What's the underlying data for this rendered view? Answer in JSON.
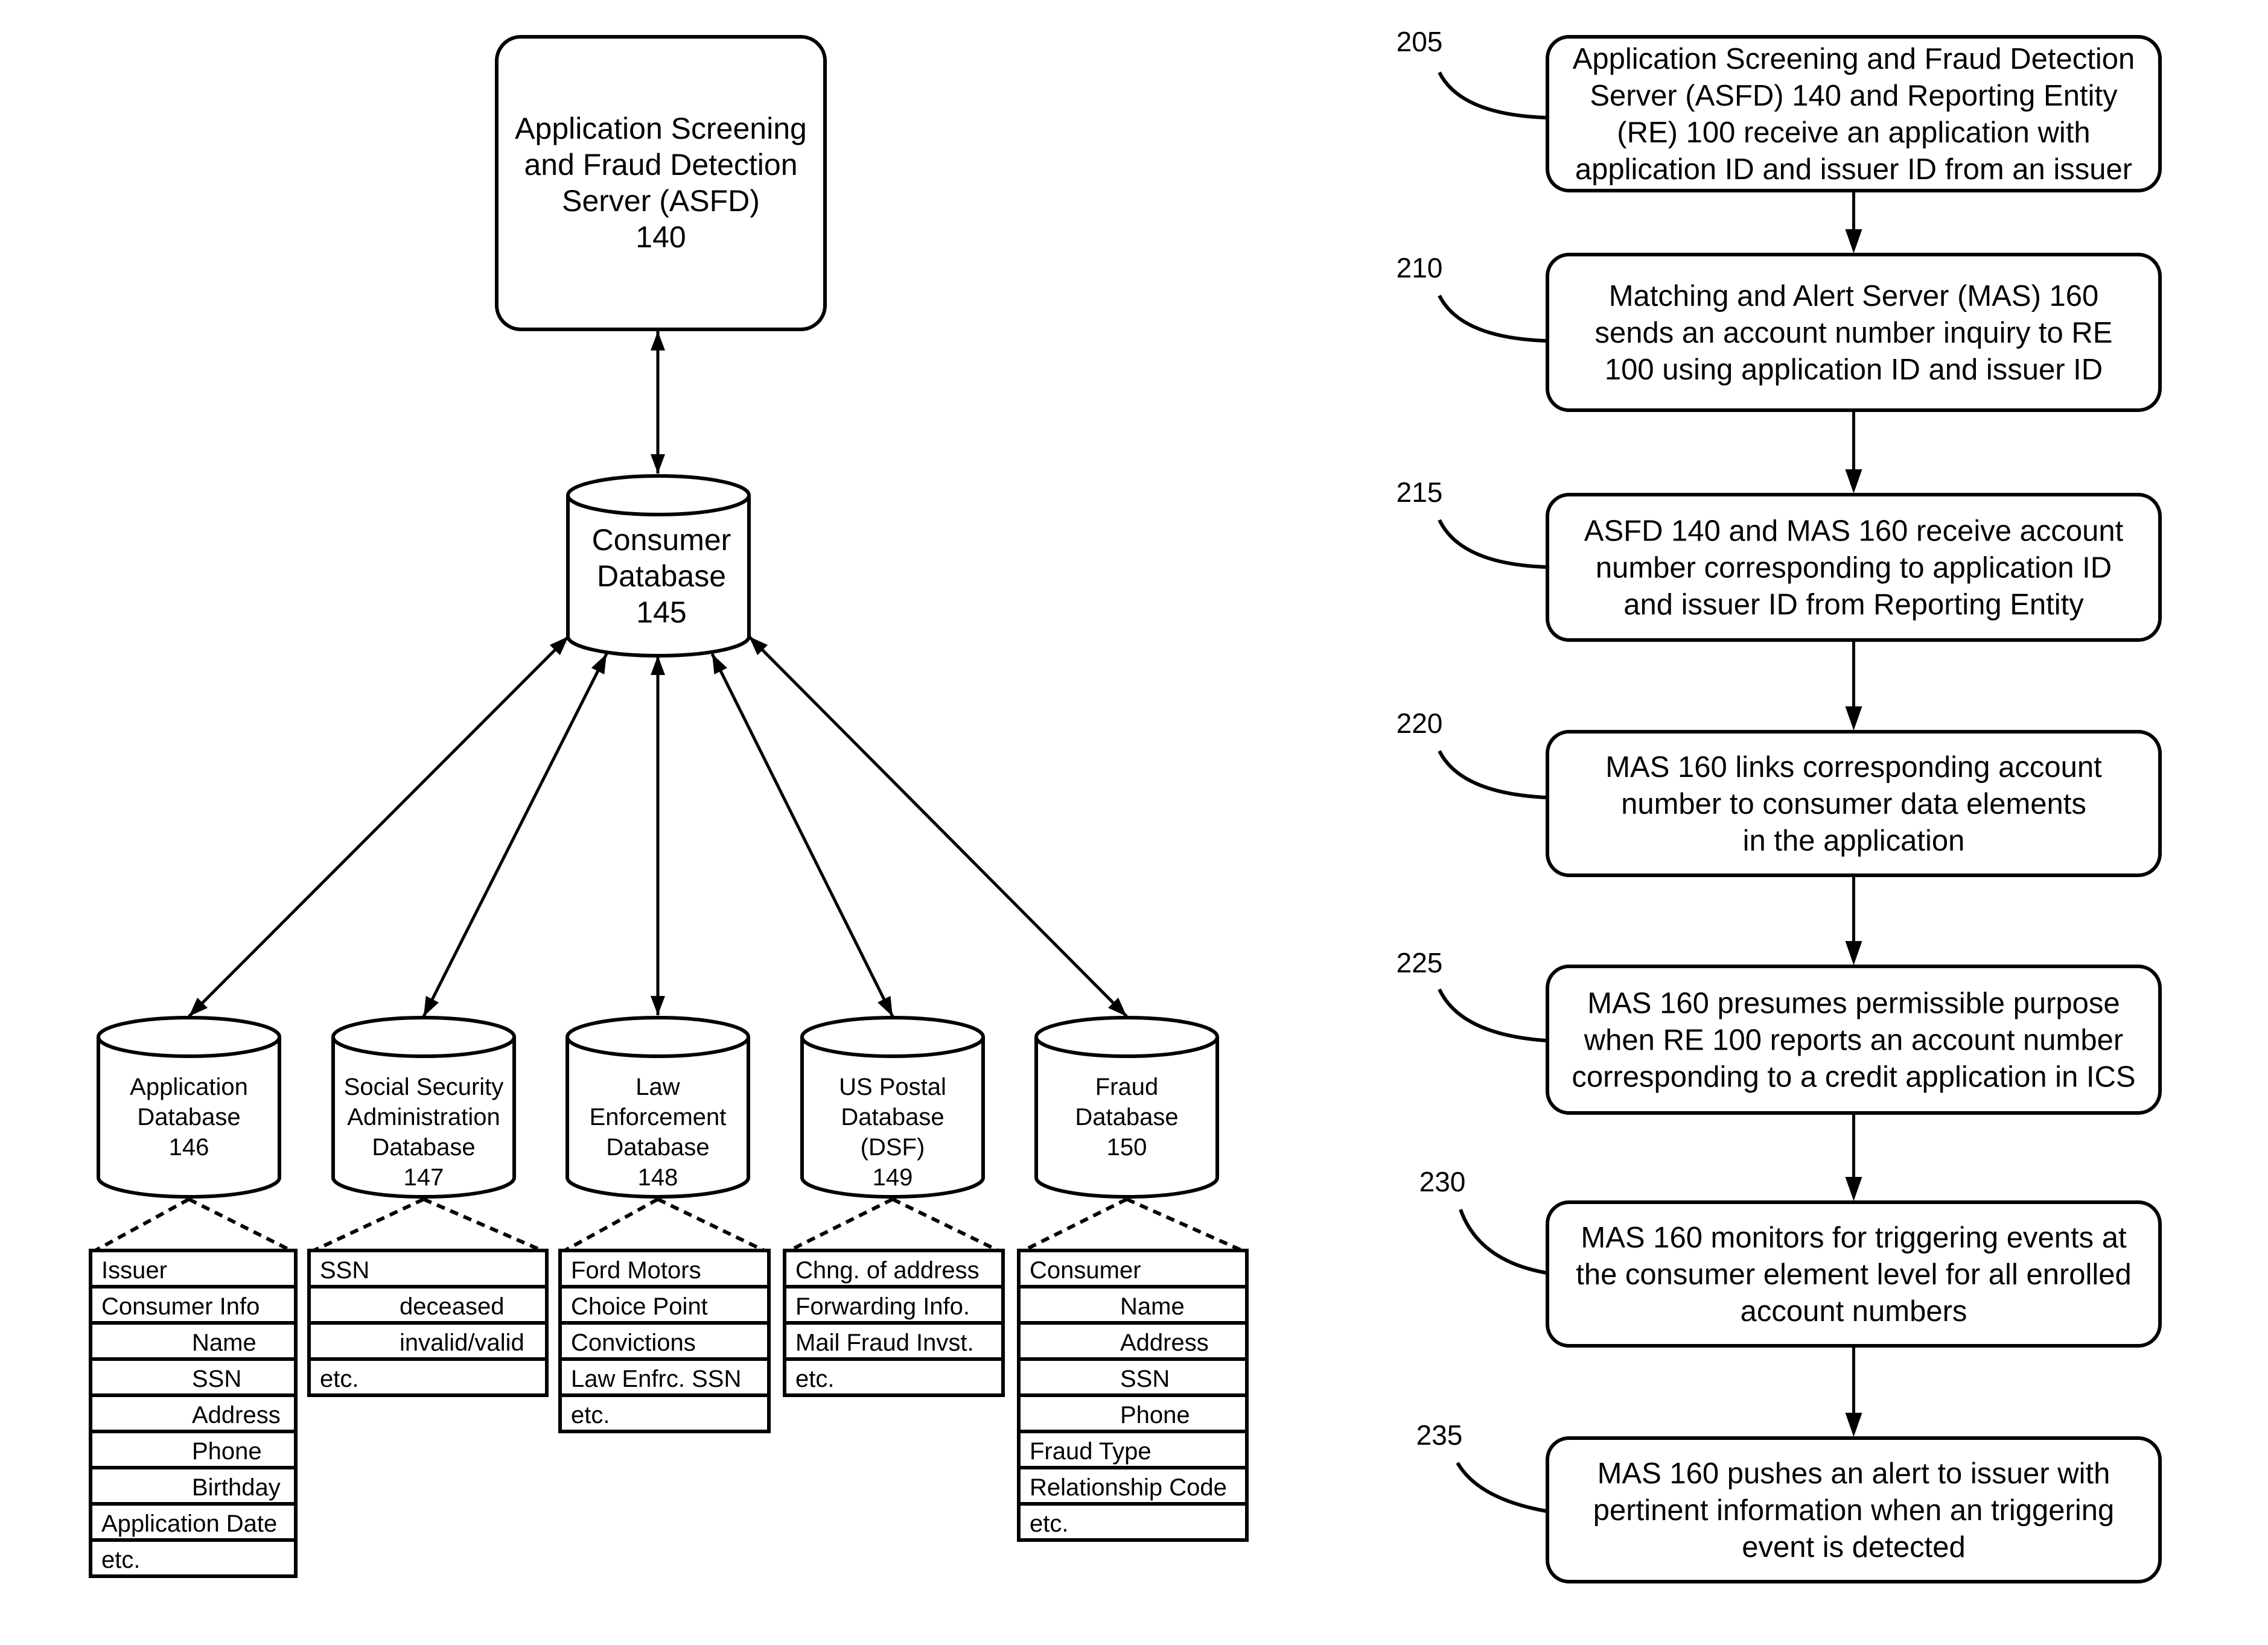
{
  "left_diagram": {
    "asfd_server": {
      "lines": [
        "Application Screening",
        "and Fraud Detection",
        "Server (ASFD)",
        "140"
      ]
    },
    "consumer_db": {
      "lines": [
        "Consumer",
        "Database",
        "145"
      ]
    },
    "databases": [
      {
        "id": "application-database",
        "lines": [
          "Application",
          "Database",
          "146"
        ],
        "rows": [
          {
            "text": "Issuer",
            "indent": false
          },
          {
            "text": "Consumer Info",
            "indent": false
          },
          {
            "text": "Name",
            "indent": true
          },
          {
            "text": "SSN",
            "indent": true
          },
          {
            "text": "Address",
            "indent": true
          },
          {
            "text": "Phone",
            "indent": true
          },
          {
            "text": "Birthday",
            "indent": true
          },
          {
            "text": "Application Date",
            "indent": false
          },
          {
            "text": "etc.",
            "indent": false
          }
        ]
      },
      {
        "id": "ssa-database",
        "lines": [
          "Social Security",
          "Administration",
          "Database",
          "147"
        ],
        "rows": [
          {
            "text": "SSN",
            "indent": false
          },
          {
            "text": "deceased",
            "indent": true
          },
          {
            "text": "invalid/valid",
            "indent": true
          },
          {
            "text": "etc.",
            "indent": false
          }
        ]
      },
      {
        "id": "law-enforcement-database",
        "lines": [
          "Law",
          "Enforcement",
          "Database",
          "148"
        ],
        "rows": [
          {
            "text": "Ford Motors",
            "indent": false
          },
          {
            "text": "Choice Point",
            "indent": false
          },
          {
            "text": "Convictions",
            "indent": false
          },
          {
            "text": "Law Enfrc. SSN",
            "indent": false
          },
          {
            "text": "etc.",
            "indent": false
          }
        ]
      },
      {
        "id": "us-postal-database",
        "lines": [
          "US Postal",
          "Database",
          "(DSF)",
          "149"
        ],
        "rows": [
          {
            "text": "Chng. of address",
            "indent": false
          },
          {
            "text": "Forwarding Info.",
            "indent": false
          },
          {
            "text": "Mail Fraud Invst.",
            "indent": false
          },
          {
            "text": "etc.",
            "indent": false
          }
        ]
      },
      {
        "id": "fraud-database",
        "lines": [
          "Fraud",
          "Database",
          "150"
        ],
        "rows": [
          {
            "text": "Consumer",
            "indent": false
          },
          {
            "text": "Name",
            "indent": true
          },
          {
            "text": "Address",
            "indent": true
          },
          {
            "text": "SSN",
            "indent": true
          },
          {
            "text": "Phone",
            "indent": true
          },
          {
            "text": "Fraud Type",
            "indent": false
          },
          {
            "text": "Relationship Code",
            "indent": false
          },
          {
            "text": "etc.",
            "indent": false
          }
        ]
      }
    ]
  },
  "flowchart": {
    "steps": [
      {
        "ref": "205",
        "lines": [
          "Application Screening and Fraud Detection",
          "Server (ASFD) 140  and Reporting Entity",
          "(RE) 100 receive an application with",
          "application ID and issuer ID from an issuer"
        ]
      },
      {
        "ref": "210",
        "lines": [
          "Matching and Alert Server (MAS) 160",
          "sends an account number inquiry to RE",
          "100 using  application ID and issuer ID"
        ]
      },
      {
        "ref": "215",
        "lines": [
          "ASFD 140 and MAS 160 receive account",
          "number corresponding to application ID",
          "and issuer ID from Reporting Entity"
        ]
      },
      {
        "ref": "220",
        "lines": [
          "MAS 160  links corresponding account",
          "number to consumer data elements",
          "in the application"
        ]
      },
      {
        "ref": "225",
        "lines": [
          "MAS 160 presumes permissible purpose",
          "when RE 100  reports an account number",
          "corresponding to a credit application in ICS"
        ]
      },
      {
        "ref": "230",
        "lines": [
          "MAS 160 monitors for triggering events at",
          "the consumer element level for all enrolled",
          "account numbers"
        ]
      },
      {
        "ref": "235",
        "lines": [
          "MAS 160 pushes an alert to issuer with",
          "pertinent information when an triggering",
          "event is detected"
        ]
      }
    ]
  }
}
